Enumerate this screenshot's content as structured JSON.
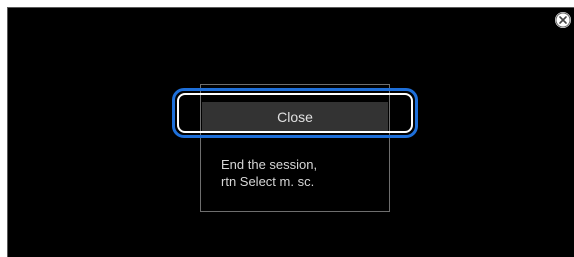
{
  "dialog": {
    "close_icon": "close-circle-icon",
    "menu_item_label": "Close",
    "description_line1": "End the session,",
    "description_line2": "rtn Select m. sc."
  },
  "colors": {
    "screen_background": "#000000",
    "menu_item_background": "#333333",
    "highlight": "#1e6fd9"
  }
}
